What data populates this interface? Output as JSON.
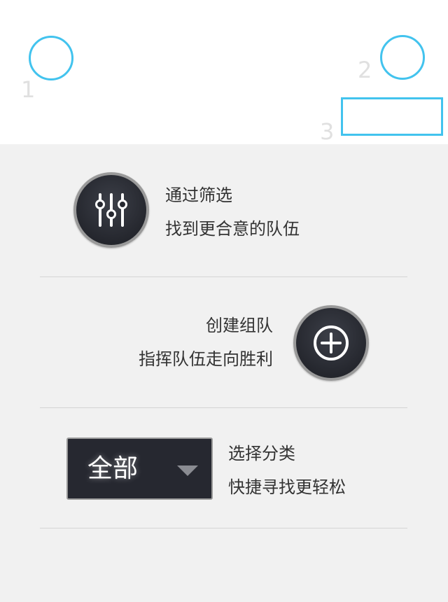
{
  "guide_markers": {
    "labels": [
      "1",
      "2",
      "3"
    ],
    "color": "#42c3ee"
  },
  "filter_section": {
    "icon": "sliders-icon",
    "line1": "通过筛选",
    "line2": "找到更合意的队伍"
  },
  "create_section": {
    "icon": "plus-circle-icon",
    "line1": "创建组队",
    "line2": "指挥队伍走向胜利"
  },
  "category_section": {
    "dropdown_value": "全部",
    "arrow_icon": "caret-down-icon",
    "line1": "选择分类",
    "line2": "快捷寻找更轻松"
  },
  "colors": {
    "highlight": "#42c3ee",
    "button_dark": "#262830",
    "background": "#f1f1f1"
  }
}
